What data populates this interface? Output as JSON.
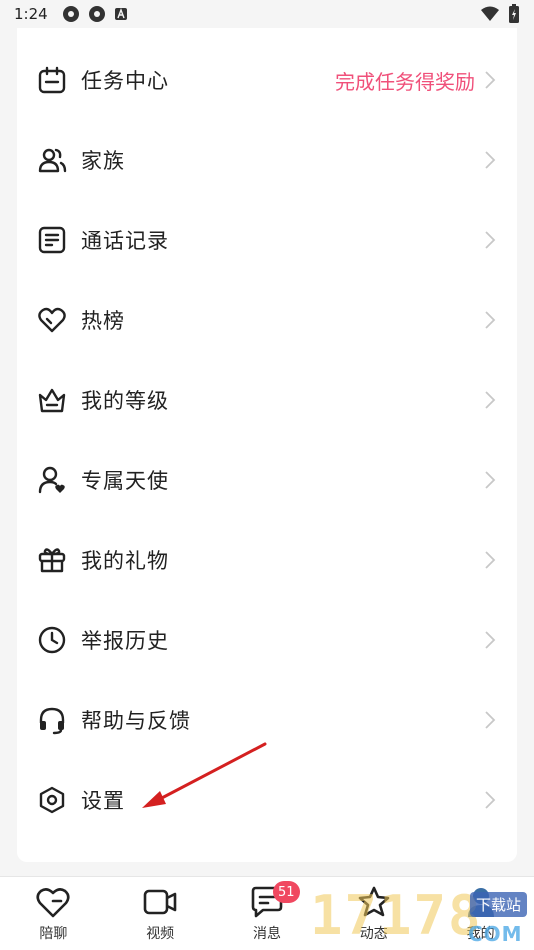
{
  "status_bar": {
    "time": "1:24"
  },
  "menu": {
    "items": [
      {
        "label": "",
        "icon": "partial-icon"
      },
      {
        "label": "任务中心",
        "icon": "calendar-icon",
        "extra": "完成任务得奖励"
      },
      {
        "label": "家族",
        "icon": "people-icon"
      },
      {
        "label": "通话记录",
        "icon": "document-icon"
      },
      {
        "label": "热榜",
        "icon": "heart-icon"
      },
      {
        "label": "我的等级",
        "icon": "crown-icon"
      },
      {
        "label": "专属天使",
        "icon": "user-heart-icon"
      },
      {
        "label": "我的礼物",
        "icon": "gift-icon"
      },
      {
        "label": "举报历史",
        "icon": "clock-icon"
      },
      {
        "label": "帮助与反馈",
        "icon": "headset-icon"
      },
      {
        "label": "设置",
        "icon": "hexagon-settings-icon"
      }
    ]
  },
  "tabbar": {
    "tabs": [
      {
        "label": "陪聊",
        "icon": "heart-chat-icon"
      },
      {
        "label": "视频",
        "icon": "video-icon"
      },
      {
        "label": "消息",
        "icon": "message-icon",
        "badge": "51"
      },
      {
        "label": "动态",
        "icon": "star-icon"
      },
      {
        "label": "我的",
        "icon": "profile-icon"
      }
    ]
  },
  "watermark": {
    "text": "17178",
    "tag": "下载站",
    "sub": "COM"
  },
  "colors": {
    "accent": "#f0507a",
    "badge": "#f04860",
    "arrow": "#d42020"
  }
}
